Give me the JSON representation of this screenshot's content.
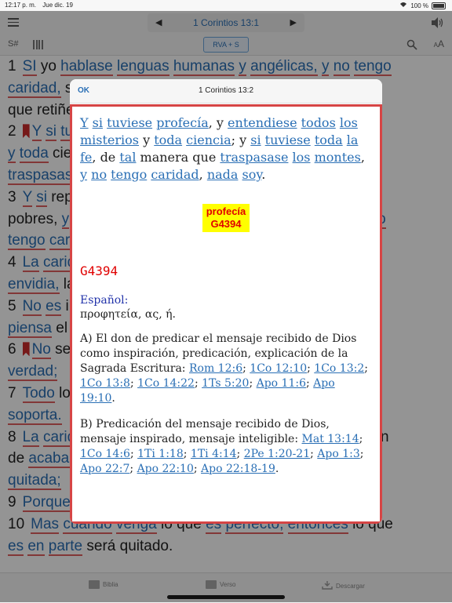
{
  "status": {
    "time": "12:17 p. m.",
    "date": "Jue dic. 19",
    "battery": "100 %"
  },
  "nav": {
    "chapter_title": "1 Corintios 13:1",
    "prev": "◀",
    "next": "▶"
  },
  "toolbar": {
    "strong_label": "S#",
    "version": "RVA + S",
    "font_label": "A",
    "font_small": "A"
  },
  "background_verses": [
    {
      "num": "1",
      "text": "SI yo hablase lenguas humanas y angélicas, y no tengo"
    },
    {
      "num": "",
      "text": "caridad, seré como metal que resuena, ó címbalo"
    },
    {
      "num": "",
      "text": "que retiñe."
    },
    {
      "num": "2",
      "text": "Y si tuviese profecía, y entendiese todos misterios"
    },
    {
      "num": "",
      "text": "y toda ciencia; y si tuviese toda la fe, de tal manera que"
    },
    {
      "num": "",
      "text": "traspasase los montes, y no tengo caridad, nada soy."
    },
    {
      "num": "3",
      "text": "Y si repartiese toda mi hacienda para dar de comer á"
    },
    {
      "num": "",
      "text": "pobres, y si entregase mi cuerpo para ser quemado, y no"
    },
    {
      "num": "",
      "text": "tengo caridad, de nada me sirve."
    },
    {
      "num": "4",
      "text": "La caridad es sufrida, es benigna; la caridad no tiene"
    },
    {
      "num": "",
      "text": "envidia, la caridad no hace sinrazón, no se ensancha;"
    },
    {
      "num": "5",
      "text": "No es injuriosa, no busca lo suyo, no se irrita, no"
    },
    {
      "num": "",
      "text": "piensa el mal;"
    },
    {
      "num": "6",
      "text": "No se huelga de la injusticia, mas se huelga de la"
    },
    {
      "num": "",
      "text": "verdad;"
    },
    {
      "num": "7",
      "text": "Todo lo sufre, todo lo cree, todo lo espera, todo lo"
    },
    {
      "num": "",
      "text": "soporta."
    },
    {
      "num": "8",
      "text": "La caridad nunca deja de ser: mas las profecías se han"
    },
    {
      "num": "",
      "text": "de acabar, y cesarán las lenguas, y la ciencia ha de ser"
    },
    {
      "num": "",
      "text": "quitada;"
    },
    {
      "num": "9",
      "text": "Porque en parte conocemos, y en parte profetizamos;"
    },
    {
      "num": "10",
      "text": "Mas cuando venga lo que es perfecto, entonces lo que"
    },
    {
      "num": "",
      "text": "es en parte será quitado."
    }
  ],
  "modal": {
    "ok_label": "OK",
    "title": "1 Corintios 13:2",
    "verse_words": [
      {
        "t": "Y",
        "l": true
      },
      {
        "t": " "
      },
      {
        "t": "si",
        "l": true
      },
      {
        "t": " "
      },
      {
        "t": "tuviese",
        "l": true
      },
      {
        "t": " "
      },
      {
        "t": "profecía",
        "l": true
      },
      {
        "t": ", y "
      },
      {
        "t": "entendiese",
        "l": true
      },
      {
        "t": " "
      },
      {
        "t": "todos",
        "l": true
      },
      {
        "t": " "
      },
      {
        "t": "los",
        "l": true
      },
      {
        "t": " "
      },
      {
        "t": "misterios",
        "l": true
      },
      {
        "t": " y "
      },
      {
        "t": "toda",
        "l": true
      },
      {
        "t": " "
      },
      {
        "t": "ciencia",
        "l": true
      },
      {
        "t": "; y "
      },
      {
        "t": "si",
        "l": true
      },
      {
        "t": " "
      },
      {
        "t": "tuviese",
        "l": true
      },
      {
        "t": " "
      },
      {
        "t": "toda",
        "l": true
      },
      {
        "t": " "
      },
      {
        "t": "la",
        "l": true
      },
      {
        "t": " "
      },
      {
        "t": "fe",
        "l": true
      },
      {
        "t": ", de "
      },
      {
        "t": "tal",
        "l": true
      },
      {
        "t": " manera que "
      },
      {
        "t": "traspasase",
        "l": true
      },
      {
        "t": " "
      },
      {
        "t": "los",
        "l": true
      },
      {
        "t": " "
      },
      {
        "t": "montes",
        "l": true
      },
      {
        "t": ", "
      },
      {
        "t": "y",
        "l": true
      },
      {
        "t": " "
      },
      {
        "t": "no",
        "l": true
      },
      {
        "t": " "
      },
      {
        "t": "tengo",
        "l": true
      },
      {
        "t": " "
      },
      {
        "t": "caridad",
        "l": true
      },
      {
        "t": ", "
      },
      {
        "t": "nada",
        "l": true
      },
      {
        "t": " "
      },
      {
        "t": "soy",
        "l": true
      },
      {
        "t": "."
      }
    ],
    "highlight_word": "profecía",
    "highlight_code": "G4394",
    "strong_code": "G4394",
    "language": "Español:",
    "greek": "προφητεία, ας, ή.",
    "def_a_text": "A) El don de predicar el mensaje recibido de Dios como inspiración, predicación, explicación de la Sagrada Escritura: ",
    "def_a_refs": [
      "Rom 12:6",
      "1Co 12:10",
      "1Co 13:2",
      "1Co 13:8",
      "1Co 14:22",
      "1Ts 5:20",
      "Apo 11:6",
      "Apo 19:10"
    ],
    "def_b_text": "B) Predicación del mensaje recibido de Dios, mensaje inspirado, mensaje inteligible: ",
    "def_b_refs": [
      "Mat 13:14",
      "1Co 14:6",
      "1Ti 1:18",
      "1Ti 4:14",
      "2Pe 1:20-21",
      "Apo 1:3",
      "Apo 22:7",
      "Apo 22:10",
      "Apo 22:18-19"
    ]
  },
  "tabs": [
    {
      "label": "Biblia",
      "icon": "book-icon"
    },
    {
      "label": "Verso",
      "icon": "open-book-icon"
    },
    {
      "label": "Descargar",
      "icon": "download-icon"
    }
  ],
  "colors": {
    "link": "#2a6fb5",
    "accent_red": "#d64545",
    "highlight": "#ffff00"
  }
}
